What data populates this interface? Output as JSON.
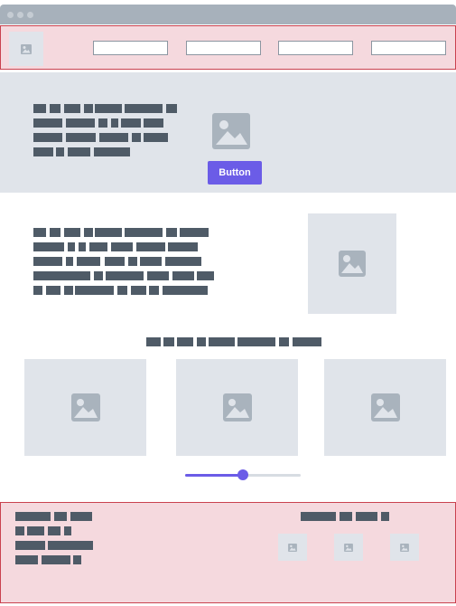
{
  "colors": {
    "accent": "#6b5ce7",
    "text_block": "#4f5b67",
    "placeholder_bg": "#e0e4ea",
    "placeholder_icon": "#a9b3bd",
    "nav_footer_bg": "#f5d9de",
    "nav_footer_border": "#c9424f",
    "titlebar": "#a7b1bb"
  },
  "window": {
    "dots": [
      "window-dot",
      "window-dot",
      "window-dot"
    ]
  },
  "nav": {
    "logo_icon": "image-icon",
    "inputs": [
      {
        "value": "",
        "placeholder": ""
      },
      {
        "value": "",
        "placeholder": ""
      },
      {
        "value": "",
        "placeholder": ""
      },
      {
        "value": "",
        "placeholder": ""
      }
    ]
  },
  "hero": {
    "image_icon": "image-icon",
    "button_label": "Button"
  },
  "gallery": {
    "image_icons": [
      "image-icon",
      "image-icon",
      "image-icon"
    ]
  },
  "slider": {
    "value": 0.5
  },
  "footer": {
    "social_icons": [
      "image-icon",
      "image-icon",
      "image-icon"
    ]
  }
}
